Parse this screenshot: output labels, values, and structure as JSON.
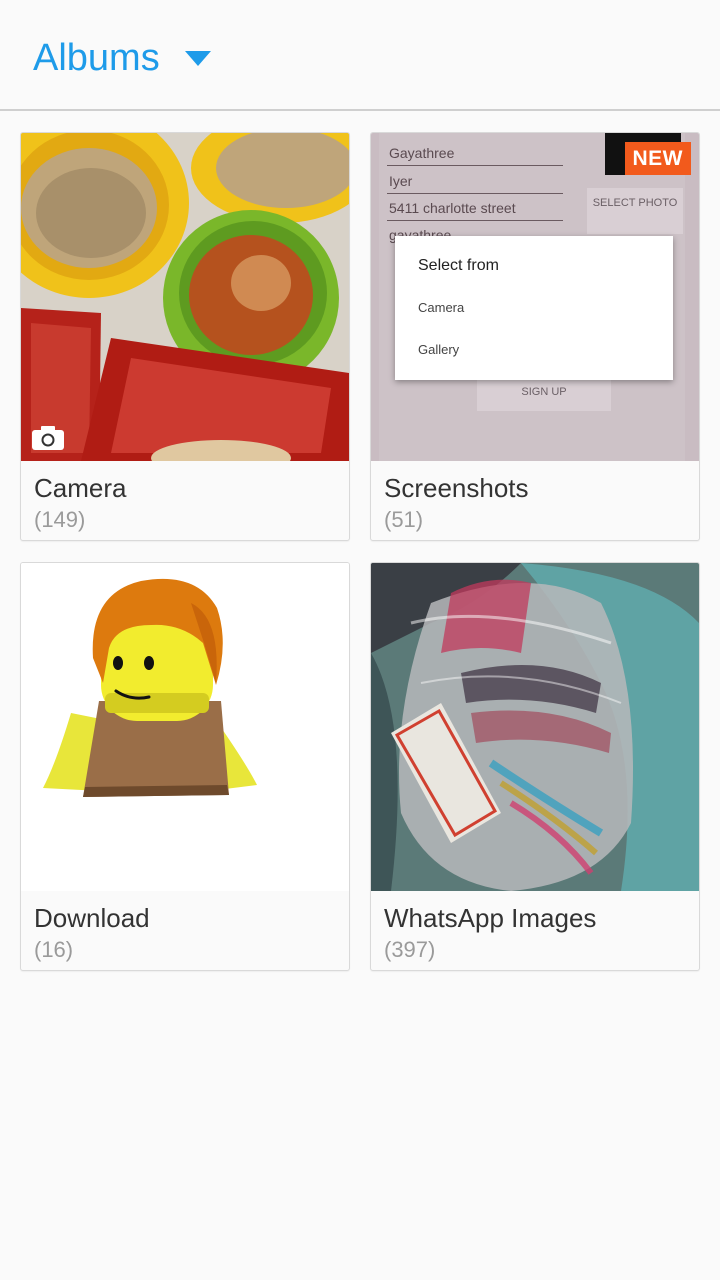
{
  "header": {
    "title": "Albums"
  },
  "albums": [
    {
      "name": "Camera",
      "count": "(149)"
    },
    {
      "name": "Screenshots",
      "count": "(51)",
      "badge": "NEW",
      "preview": {
        "fields": [
          "Gayathree",
          "Iyer",
          "5411 charlotte street",
          "gayathree"
        ],
        "select_button": "SELECT PHOTO",
        "signup_button": "SIGN UP",
        "dialog_title": "Select from",
        "dialog_options": [
          "Camera",
          "Gallery"
        ]
      }
    },
    {
      "name": "Download",
      "count": "(16)"
    },
    {
      "name": "WhatsApp Images",
      "count": "(397)"
    }
  ],
  "colors": {
    "accent": "#1e9be9",
    "badge": "#f25a1c"
  }
}
